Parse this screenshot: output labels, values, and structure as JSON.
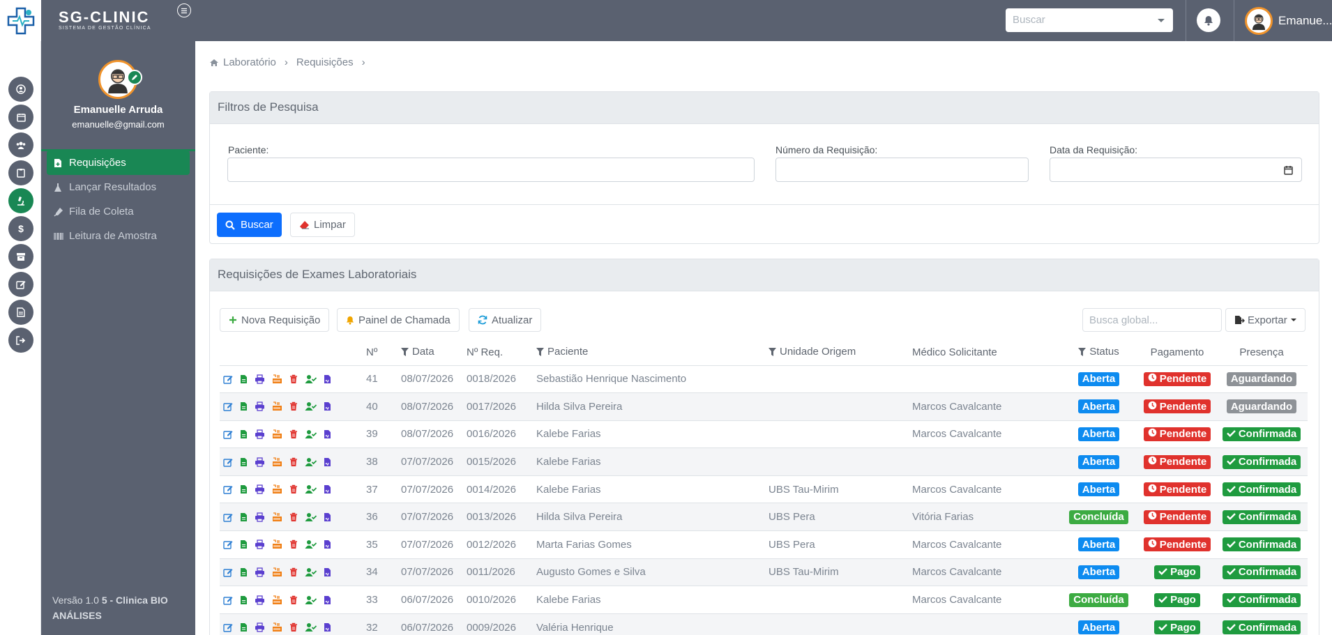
{
  "app": {
    "brand_title": "SG-CLINIC",
    "brand_subtitle": "SISTEMA DE GESTÃO CLÍNICA",
    "search_placeholder": "Buscar",
    "user_short": "Emanue..."
  },
  "rail": {
    "icons": [
      "user-circle-icon",
      "calendar-icon",
      "users-icon",
      "clipboard-icon",
      "microscope-icon",
      "dollar-icon",
      "archive-icon",
      "edit-icon",
      "document-icon",
      "logout-icon"
    ],
    "active_index": 4
  },
  "sidebar": {
    "name": "Emanuelle Arruda",
    "email": "emanuelle@gmail.com",
    "items": [
      {
        "label": "Requisições",
        "icon": "file-plus-icon",
        "active": true
      },
      {
        "label": "Lançar Resultados",
        "icon": "flask-icon",
        "active": false
      },
      {
        "label": "Fila de Coleta",
        "icon": "syringe-icon",
        "active": false
      },
      {
        "label": "Leitura de Amostra",
        "icon": "barcode-icon",
        "active": false
      }
    ],
    "version_prefix": "Versão 1.0",
    "version_bold": "5 - Clinica BIO ANÁLISES"
  },
  "breadcrumb": [
    "Laboratório",
    "Requisições"
  ],
  "filters": {
    "title": "Filtros de Pesquisa",
    "paciente_label": "Paciente:",
    "numero_label": "Número da Requisição:",
    "data_label": "Data da Requisição:",
    "search_btn": "Buscar",
    "clear_btn": "Limpar"
  },
  "results": {
    "title": "Requisições de Exames Laboratoriais",
    "new_btn": "Nova Requisição",
    "panel_btn": "Painel de Chamada",
    "refresh_btn": "Atualizar",
    "global_search_placeholder": "Busca global...",
    "export_btn": "Exportar",
    "columns": [
      "Nº",
      "Data",
      "Nº Req.",
      "Paciente",
      "Unidade Origem",
      "Médico Solicitante",
      "Status",
      "Pagamento",
      "Presença"
    ],
    "rows": [
      {
        "n": "41",
        "data": "08/07/2026",
        "req": "0018/2026",
        "paciente": "Sebastião Henrique Nascimento",
        "unidade": "",
        "medico": "",
        "status": "Aberta",
        "pagamento": "Pendente",
        "presenca": "Aguardando"
      },
      {
        "n": "40",
        "data": "08/07/2026",
        "req": "0017/2026",
        "paciente": "Hilda Silva Pereira",
        "unidade": "",
        "medico": "Marcos Cavalcante",
        "status": "Aberta",
        "pagamento": "Pendente",
        "presenca": "Aguardando"
      },
      {
        "n": "39",
        "data": "08/07/2026",
        "req": "0016/2026",
        "paciente": "Kalebe Farias",
        "unidade": "",
        "medico": "Marcos Cavalcante",
        "status": "Aberta",
        "pagamento": "Pendente",
        "presenca": "Confirmada"
      },
      {
        "n": "38",
        "data": "07/07/2026",
        "req": "0015/2026",
        "paciente": "Kalebe Farias",
        "unidade": "",
        "medico": "",
        "status": "Aberta",
        "pagamento": "Pendente",
        "presenca": "Confirmada"
      },
      {
        "n": "37",
        "data": "07/07/2026",
        "req": "0014/2026",
        "paciente": "Kalebe Farias",
        "unidade": "UBS Tau-Mirim",
        "medico": "Marcos Cavalcante",
        "status": "Aberta",
        "pagamento": "Pendente",
        "presenca": "Confirmada"
      },
      {
        "n": "36",
        "data": "07/07/2026",
        "req": "0013/2026",
        "paciente": "Hilda Silva Pereira",
        "unidade": "UBS Pera",
        "medico": "Vitória Farias",
        "status": "Concluída",
        "pagamento": "Pendente",
        "presenca": "Confirmada"
      },
      {
        "n": "35",
        "data": "07/07/2026",
        "req": "0012/2026",
        "paciente": "Marta Farias Gomes",
        "unidade": "UBS Pera",
        "medico": "Marcos Cavalcante",
        "status": "Aberta",
        "pagamento": "Pendente",
        "presenca": "Confirmada"
      },
      {
        "n": "34",
        "data": "07/07/2026",
        "req": "0011/2026",
        "paciente": "Augusto Gomes e Silva",
        "unidade": "UBS Tau-Mirim",
        "medico": "Marcos Cavalcante",
        "status": "Aberta",
        "pagamento": "Pago",
        "presenca": "Confirmada"
      },
      {
        "n": "33",
        "data": "06/07/2026",
        "req": "0010/2026",
        "paciente": "Kalebe Farias",
        "unidade": "",
        "medico": "Marcos Cavalcante",
        "status": "Concluída",
        "pagamento": "Pago",
        "presenca": "Confirmada"
      },
      {
        "n": "32",
        "data": "06/07/2026",
        "req": "0009/2026",
        "paciente": "Valéria Henrique",
        "unidade": "",
        "medico": "",
        "status": "Aberta",
        "pagamento": "Pago",
        "presenca": "Confirmada"
      }
    ]
  }
}
